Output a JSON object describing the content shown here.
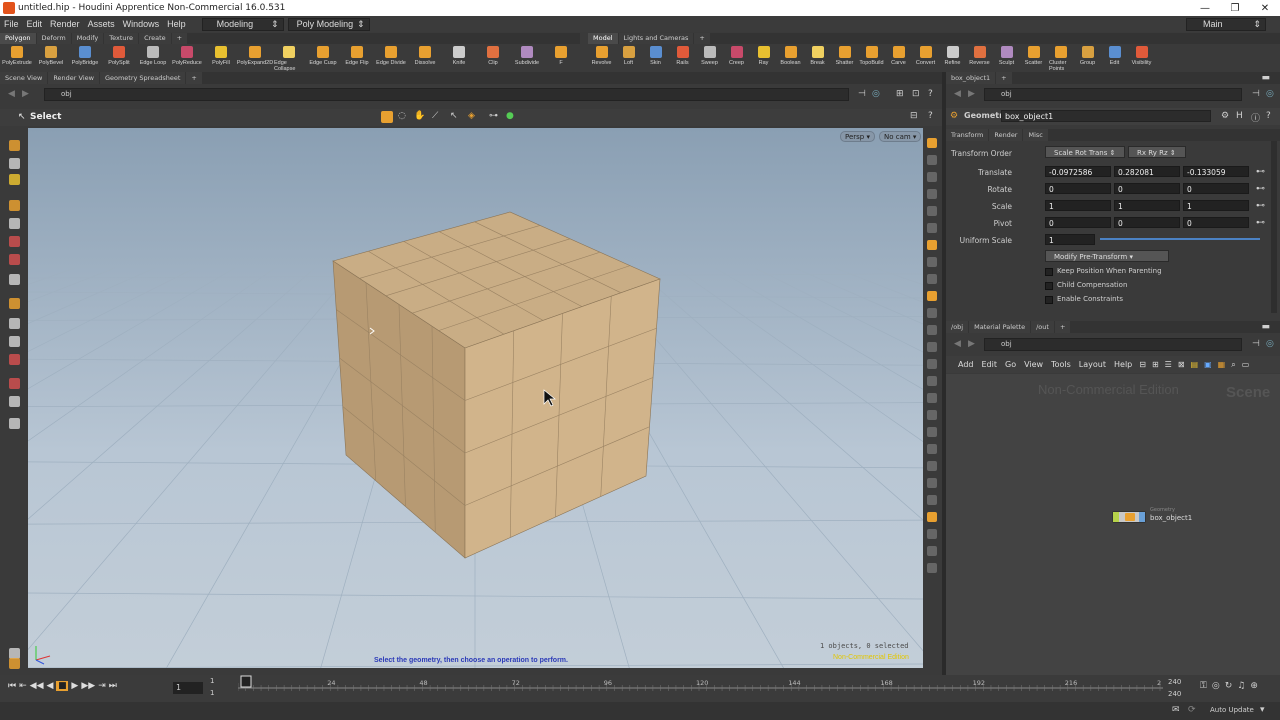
{
  "window": {
    "title": "untitled.hip - Houdini Apprentice Non-Commercial 16.0.531",
    "controls": [
      "—",
      "❐",
      "✕"
    ]
  },
  "menu": {
    "items": [
      "File",
      "Edit",
      "Render",
      "Assets",
      "Windows",
      "Help"
    ],
    "desktop": "Modeling",
    "context": "Poly Modeling",
    "workspace": "Main"
  },
  "shelf1": {
    "tabs": [
      "Polygon",
      "Deform",
      "Modify",
      "Texture",
      "Create"
    ],
    "tools": [
      "PolyExtrude",
      "PolyBevel",
      "PolyBridge",
      "PolySplit",
      "Edge Loop",
      "PolyReduce",
      "PolyFill",
      "PolyExpand2D",
      "Edge Collapse",
      "Edge Cusp",
      "Edge Flip",
      "Edge Divide",
      "Dissolve",
      "Knife",
      "Clip",
      "Subdivide",
      "F"
    ]
  },
  "shelf2": {
    "tabs": [
      "Model",
      "Lights and Cameras"
    ],
    "tools": [
      "Revolve",
      "Loft",
      "Skin",
      "Rails",
      "Sweep",
      "Creep",
      "Ray",
      "Boolean",
      "Break",
      "Shatter",
      "TopoBuild",
      "Carve",
      "Convert",
      "Refine",
      "Reverse",
      "Sculpt",
      "Scatter",
      "Cluster Points",
      "Group",
      "Edit",
      "Visibility"
    ]
  },
  "viewer": {
    "tabs": [
      "Scene View",
      "Render View",
      "Geometry Spreadsheet"
    ],
    "path": "obj",
    "tool": "Select",
    "cam_persp": "Persp",
    "cam_nocam": "No cam",
    "prompt": "Select the geometry, then choose an operation to perform.",
    "selection": "1 objects, 0 selected",
    "watermark": "Non-Commercial Edition"
  },
  "timeline": {
    "frame": "1",
    "start": "1",
    "start2": "1",
    "ticks": [
      "1",
      "24",
      "48",
      "72",
      "96",
      "120",
      "144",
      "168",
      "192",
      "216",
      "2"
    ],
    "end": "240",
    "end2": "240",
    "current_frame_fraction": 0.0
  },
  "status": {
    "auto_update": "Auto Update"
  },
  "params": {
    "tabs": [
      "box_object1"
    ],
    "path": "obj",
    "node_type": "Geometry",
    "node_name": "box_object1",
    "subtabs": [
      "Transform",
      "Render",
      "Misc"
    ],
    "transform_order_label": "Transform Order",
    "transform_order": "Scale Rot Trans",
    "rot_order": "Rx Ry Rz",
    "rows": [
      {
        "label": "Translate",
        "values": [
          "-0.0972586",
          "0.282081",
          "-0.133059"
        ]
      },
      {
        "label": "Rotate",
        "values": [
          "0",
          "0",
          "0"
        ]
      },
      {
        "label": "Scale",
        "values": [
          "1",
          "1",
          "1"
        ]
      },
      {
        "label": "Pivot",
        "values": [
          "0",
          "0",
          "0"
        ]
      }
    ],
    "uniform_scale_label": "Uniform Scale",
    "uniform_scale": "1",
    "modify_pre": "Modify Pre-Transform",
    "checkboxes": [
      "Keep Position When Parenting",
      "Child Compensation",
      "Enable Constraints"
    ]
  },
  "network": {
    "tabs": [
      "/obj",
      "Material Palette",
      "/out"
    ],
    "path": "obj",
    "menu": [
      "Add",
      "Edit",
      "Go",
      "View",
      "Tools",
      "Layout",
      "Help"
    ],
    "watermark": "Non-Commercial Edition",
    "context_label": "Scene",
    "node_type": "Geometry",
    "node_name": "box_object1"
  }
}
